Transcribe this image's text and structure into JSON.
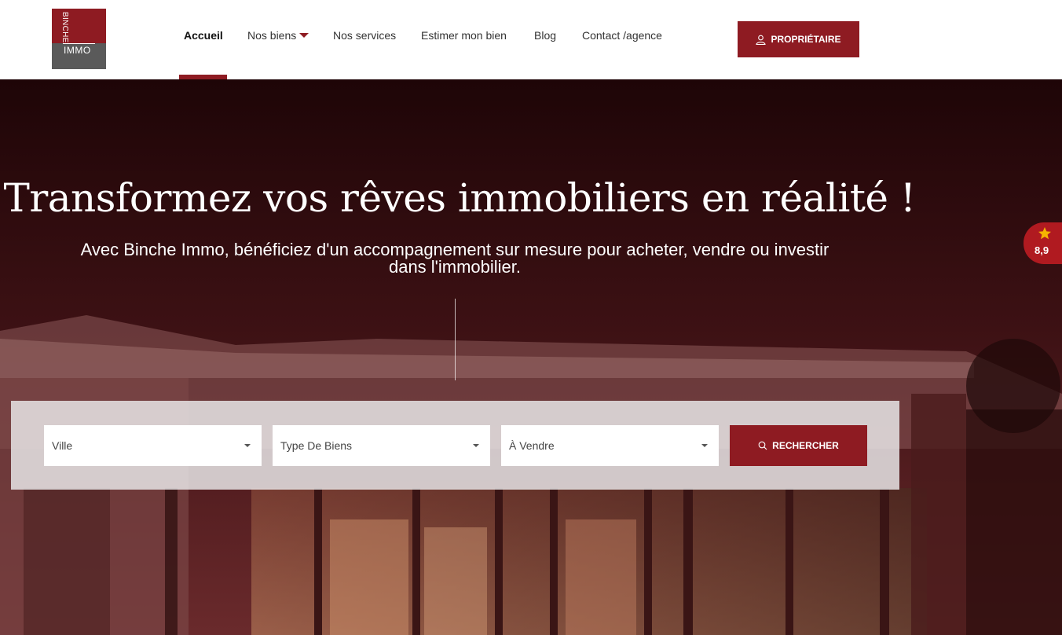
{
  "logo": {
    "vertical_text": "BINCHE",
    "bottom_text": "IMMO"
  },
  "nav": {
    "items": [
      {
        "label": "Accueil"
      },
      {
        "label": "Nos biens"
      },
      {
        "label": "Nos services"
      },
      {
        "label": "Estimer mon bien"
      },
      {
        "label": "Blog"
      },
      {
        "label": "Contact /agence"
      }
    ],
    "owner_button": "PROPRIÉTAIRE"
  },
  "hero": {
    "title": "Transformez vos rêves immobiliers en réalité !",
    "subtitle_line1": "Avec Binche Immo, bénéficiez d'un accompagnement sur mesure pour acheter, vendre ou investir",
    "subtitle_line2": "dans l'immobilier."
  },
  "search": {
    "city_select": "Ville",
    "type_select": "Type De Biens",
    "transaction_select": "À Vendre",
    "button": "RECHERCHER"
  },
  "rating": {
    "score": "8,9"
  },
  "colors": {
    "brand": "#8e1b22",
    "badge": "#b01a20",
    "star": "#f5b301"
  }
}
